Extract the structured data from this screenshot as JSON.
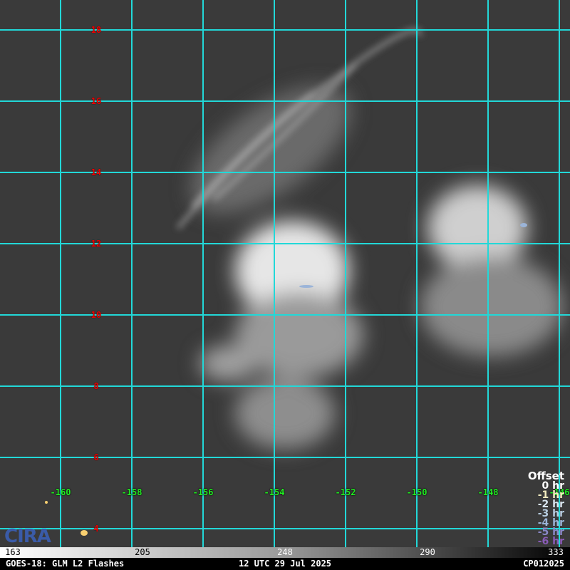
{
  "latitude_labels": [
    "18",
    "16",
    "14",
    "12",
    "10",
    "8",
    "6",
    "4"
  ],
  "longitude_labels": [
    "-160",
    "-158",
    "-156",
    "-154",
    "-152",
    "-150",
    "-148",
    "-146"
  ],
  "legend": {
    "title": "Offset",
    "items": [
      {
        "label": "0 hr",
        "color": "#ffffff"
      },
      {
        "label": "-1 hr",
        "color": "#f3ecc0"
      },
      {
        "label": "-2 hr",
        "color": "#d8e4ee"
      },
      {
        "label": "-3 hr",
        "color": "#b7cde0"
      },
      {
        "label": "-4 hr",
        "color": "#9bb4d8"
      },
      {
        "label": "-5 hr",
        "color": "#8a88c8"
      },
      {
        "label": "-6 hr",
        "color": "#8a5cb8"
      }
    ]
  },
  "colorbar": {
    "ticks": [
      "163",
      "205",
      "248",
      "290",
      "333"
    ]
  },
  "footer": {
    "left": "GOES-18: GLM L2 Flashes",
    "center": "12 UTC 29 Jul 2025",
    "right": "CP012025"
  },
  "logo": "CIRA",
  "colors": {
    "grid": "#22d8d8",
    "lat": "#ee0000",
    "lon": "#22ee22"
  }
}
